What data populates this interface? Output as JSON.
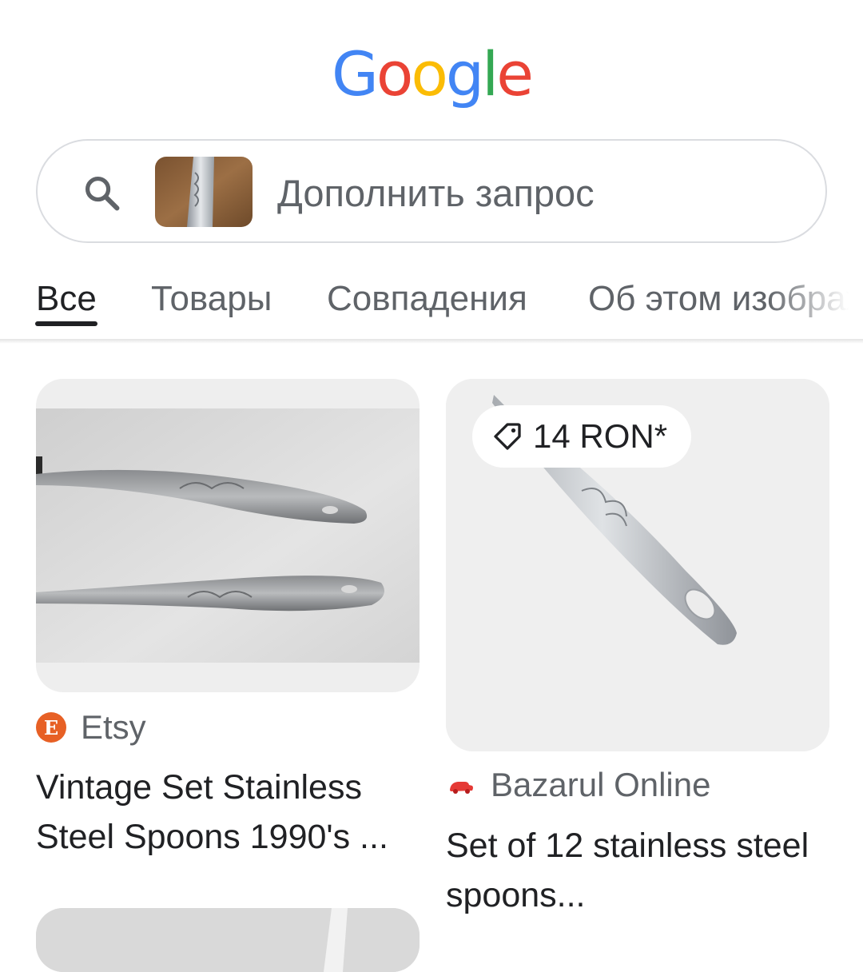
{
  "logo": {
    "letters": [
      "G",
      "o",
      "o",
      "g",
      "l",
      "e"
    ],
    "colors": [
      "#4285F4",
      "#EA4335",
      "#FBBC05",
      "#4285F4",
      "#34A853",
      "#EA4335"
    ]
  },
  "search": {
    "placeholder": "Дополнить запрос",
    "icon": "search-icon"
  },
  "tabs": [
    {
      "label": "Все",
      "active": true
    },
    {
      "label": "Товары",
      "active": false
    },
    {
      "label": "Совпадения",
      "active": false
    },
    {
      "label": "Об этом изображении",
      "active": false
    }
  ],
  "results": [
    {
      "source": "Etsy",
      "source_icon": "etsy-icon",
      "title": "Vintage Set Stainless Steel Spoons 1990's ..."
    },
    {
      "source": "Bazarul Online",
      "source_icon": "bazarul-online-icon",
      "price": "14 RON*",
      "price_icon": "price-tag-icon",
      "title": "Set of 12 stainless steel spoons..."
    }
  ],
  "colors": {
    "text_primary": "#202124",
    "text_secondary": "#5f6368",
    "border": "#dadce0",
    "etsy": "#e76025"
  }
}
